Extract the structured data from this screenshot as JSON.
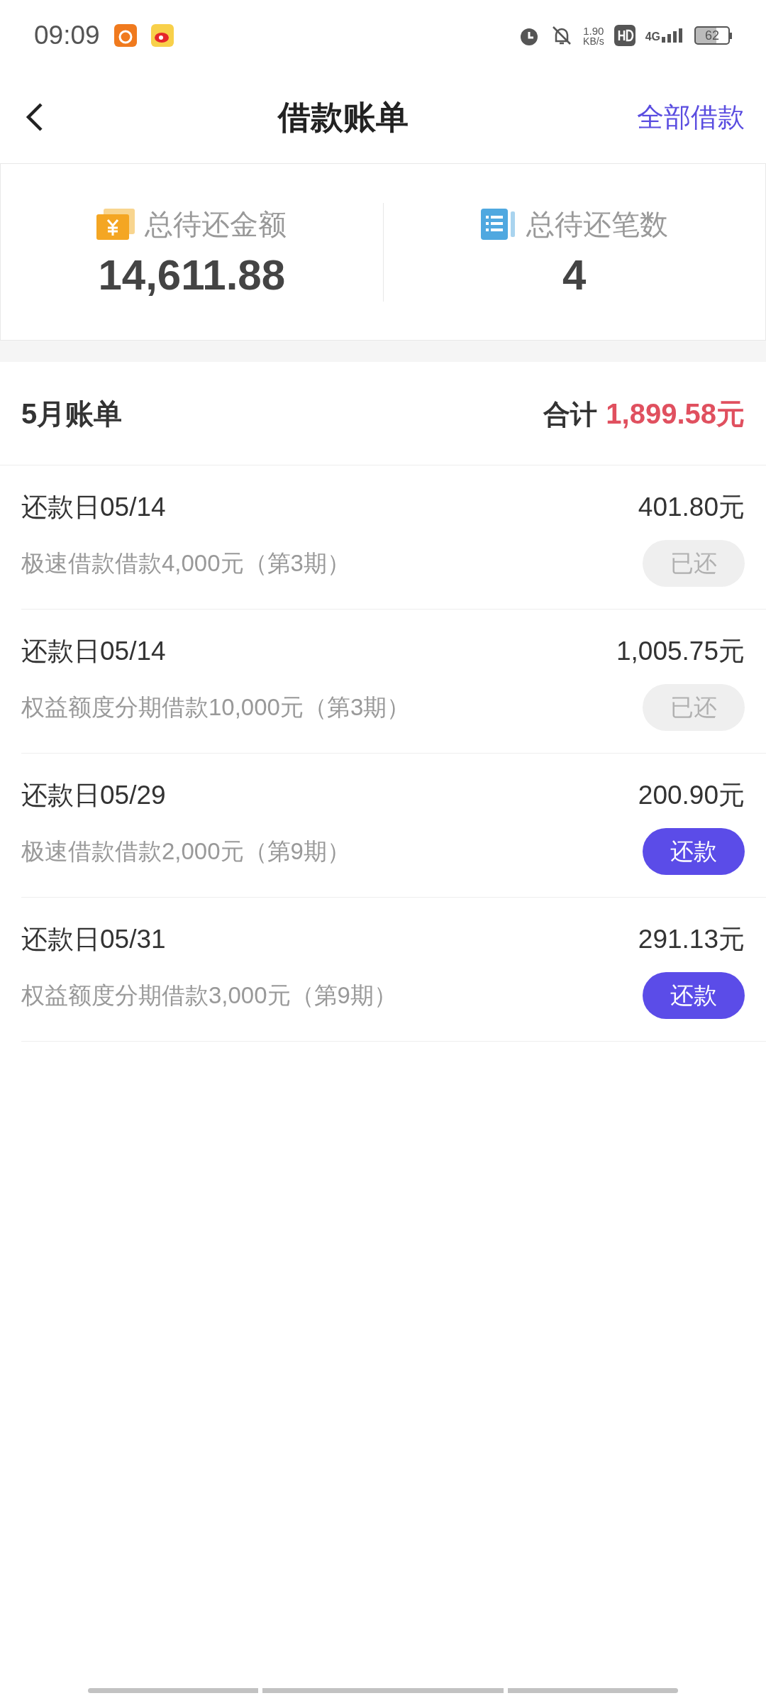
{
  "status_bar": {
    "time": "09:09",
    "speed": "1.90",
    "speed_unit": "KB/s",
    "network": "4G",
    "battery": "62"
  },
  "header": {
    "title": "借款账单",
    "action": "全部借款"
  },
  "summary": [
    {
      "kind": "money",
      "label": "总待还金额",
      "value": "14,611.88"
    },
    {
      "kind": "list",
      "label": "总待还笔数",
      "value": "4"
    }
  ],
  "month": {
    "title": "5月账单",
    "total_label": "合计",
    "total": "1,899.58元"
  },
  "bills": [
    {
      "date": "还款日05/14",
      "amount": "401.80元",
      "desc": "极速借款借款4,000元（第3期）",
      "button": "已还",
      "disabled": true
    },
    {
      "date": "还款日05/14",
      "amount": "1,005.75元",
      "desc": "权益额度分期借款10,000元（第3期）",
      "button": "已还",
      "disabled": true
    },
    {
      "date": "还款日05/29",
      "amount": "200.90元",
      "desc": "极速借款借款2,000元（第9期）",
      "button": "还款",
      "disabled": false
    },
    {
      "date": "还款日05/31",
      "amount": "291.13元",
      "desc": "权益额度分期借款3,000元（第9期）",
      "button": "还款",
      "disabled": false
    }
  ]
}
